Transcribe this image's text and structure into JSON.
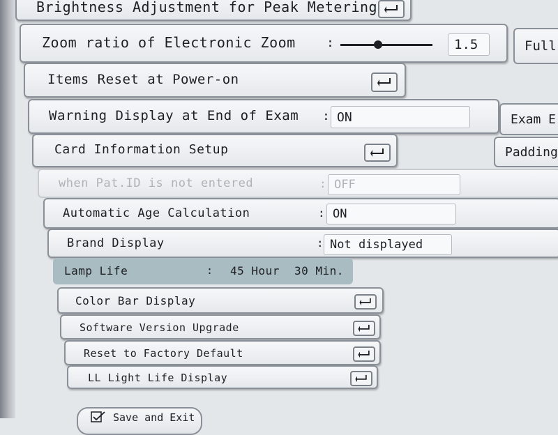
{
  "settings": {
    "brightness_label": "Brightness Adjustment for Peak Metering",
    "zoom_label": "Zoom ratio of Electronic Zoom",
    "zoom_value": "1.5",
    "zoom_level": 0.4,
    "zoom_side_button": "Full",
    "items_reset_label": "Items Reset at Power-on",
    "warning_label": "Warning Display at End of Exam",
    "warning_value": "ON",
    "warning_side_button": "Exam E",
    "card_info_label": "Card Information Setup",
    "card_info_side_button": "Padding",
    "pat_id_label": "when Pat.ID is not entered",
    "pat_id_value": "OFF",
    "age_calc_label": "Automatic Age Calculation",
    "age_calc_value": "ON",
    "brand_label": "Brand Display",
    "brand_value": "Not displayed",
    "lamp_label": "Lamp Life",
    "lamp_hours": "45 Hour",
    "lamp_minutes": "30 Min.",
    "color_bar_label": "Color Bar Display",
    "software_label": "Software Version Upgrade",
    "factory_reset_label": "Reset to Factory Default",
    "ll_light_label": "LL Light Life Display",
    "save_exit_label": "Save and Exit",
    "colon": ":"
  },
  "icons": {
    "enter": "enter-return-icon",
    "check": "check-icon"
  },
  "colors": {
    "lamp_highlight": "#a9bcc1",
    "disabled_text": "#aeb3b8"
  }
}
